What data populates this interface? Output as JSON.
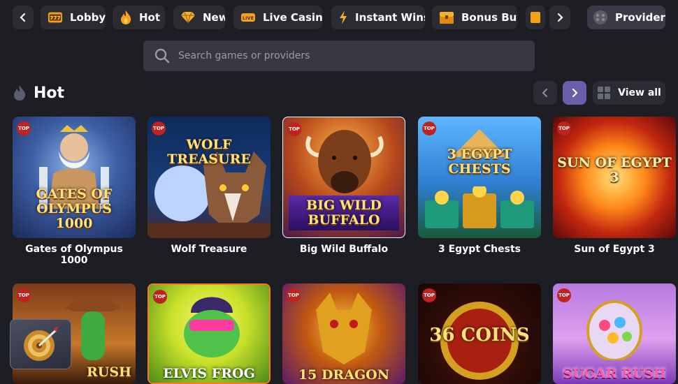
{
  "nav": {
    "categories": [
      {
        "label": "Lobby",
        "icon": "slot-777-icon"
      },
      {
        "label": "Hot",
        "icon": "flame-icon"
      },
      {
        "label": "New",
        "icon": "diamond-icon"
      },
      {
        "label": "Live Casino",
        "icon": "live-icon"
      },
      {
        "label": "Instant Wins",
        "icon": "lightning-icon"
      },
      {
        "label": "Bonus Buy",
        "icon": "chest-icon"
      }
    ],
    "providers_label": "Providers"
  },
  "search": {
    "placeholder": "Search games or providers"
  },
  "section": {
    "title": "Hot",
    "view_all": "View all"
  },
  "badge_text": "TOP",
  "games_row1": [
    {
      "name": "Gates of Olympus 1000",
      "art_title": "GATES OF OLYMPUS 1000"
    },
    {
      "name": "Wolf Treasure",
      "art_title": "WOLF TREASURE"
    },
    {
      "name": "Big Wild Buffalo",
      "art_title": "BIG WILD BUFFALO"
    },
    {
      "name": "3 Egypt Chests",
      "art_title": "3 EGYPT CHESTS"
    },
    {
      "name": "Sun of Egypt 3",
      "art_title": "SUN OF EGYPT 3"
    }
  ],
  "games_row2": [
    {
      "art_title": "RUSH"
    },
    {
      "art_title": "ELVIS FROG"
    },
    {
      "art_title": "15 DRAGON"
    },
    {
      "art_title": "36 COINS"
    },
    {
      "art_title": "SUGAR RUSH"
    }
  ],
  "colors": {
    "accent": "#6b5ea8",
    "background": "#1d1e24",
    "surface": "#2a2b33",
    "badge": "#c0221f"
  }
}
